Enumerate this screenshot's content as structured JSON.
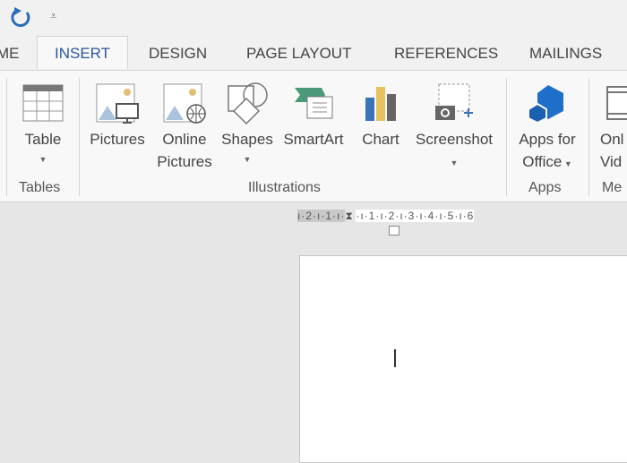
{
  "quick_access": {
    "undo_icon": "redo-icon",
    "customize_icon": "customize-quick-access-icon"
  },
  "tabs": [
    {
      "label": "ME"
    },
    {
      "label": "INSERT",
      "active": true
    },
    {
      "label": "DESIGN"
    },
    {
      "label": "PAGE LAYOUT"
    },
    {
      "label": "REFERENCES"
    },
    {
      "label": "MAILINGS"
    }
  ],
  "ribbon": {
    "groups": [
      {
        "label": "Tables"
      },
      {
        "label": "Illustrations"
      },
      {
        "label": "Apps"
      },
      {
        "label": "Me"
      }
    ],
    "buttons": {
      "table": "Table",
      "pictures": "Pictures",
      "online_pictures_1": "Online",
      "online_pictures_2": "Pictures",
      "shapes": "Shapes",
      "smartart": "SmartArt",
      "chart": "Chart",
      "screenshot": "Screenshot",
      "apps_1": "Apps for",
      "apps_2": "Office",
      "video_1": "Onl",
      "video_2": "Vid"
    }
  },
  "ruler": {
    "left": "ı·2·ı·1·ı·",
    "right": "·ı·1·ı·2·ı·3·ı·4·ı·5·ı·6"
  },
  "colors": {
    "accent": "#2b579a",
    "apps_blue": "#1e6fc8"
  }
}
